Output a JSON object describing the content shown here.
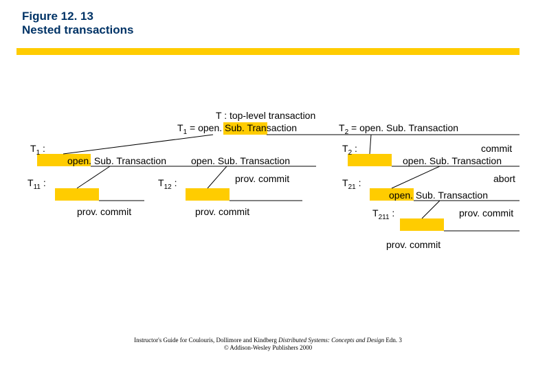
{
  "figure": {
    "number": "Figure 12. 13",
    "title": "Nested transactions"
  },
  "labels": {
    "top": "T  : top-level transaction",
    "t1_eq": "T",
    "t1_eq_sub": "1",
    "t1_eq_rest": " = open. Sub. Transaction",
    "t2_eq": "T",
    "t2_eq_sub": "2",
    "t2_eq_rest": " = open. Sub. Transaction",
    "t1": "T",
    "t1_sub": "1",
    "t1_colon": " :",
    "t2": "T",
    "t2_sub": "2",
    "t2_colon": " :",
    "commit": "commit",
    "openSub_a": "open. Sub. Transaction",
    "openSub_b": "open. Sub. Transaction",
    "openSub_c": "open. Sub. Transaction",
    "t11": "T",
    "t11_sub": "11",
    "t11_colon": " :",
    "t12": "T",
    "t12_sub": "12",
    "t12_colon": " :",
    "t21": "T",
    "t21_sub": "21",
    "t21_colon": " :",
    "prov_commit_tr": "prov. commit",
    "abort": "abort",
    "openSub_d": "open. Sub. Transaction",
    "prov_commit_bl": "prov. commit",
    "prov_commit_bm": "prov. commit",
    "t211": "T",
    "t211_sub": "211",
    "t211_colon": " :",
    "prov_commit_br": "prov. commit",
    "prov_commit_bottom": "prov. commit"
  },
  "footer": {
    "line1a": "Instructor's Guide for Coulouris, Dollimore and Kindberg ",
    "line1b": "Distributed Systems: Concepts and Design",
    "line1c": "  Edn. 3",
    "line2": "© Addison-Wesley Publishers 2000"
  }
}
